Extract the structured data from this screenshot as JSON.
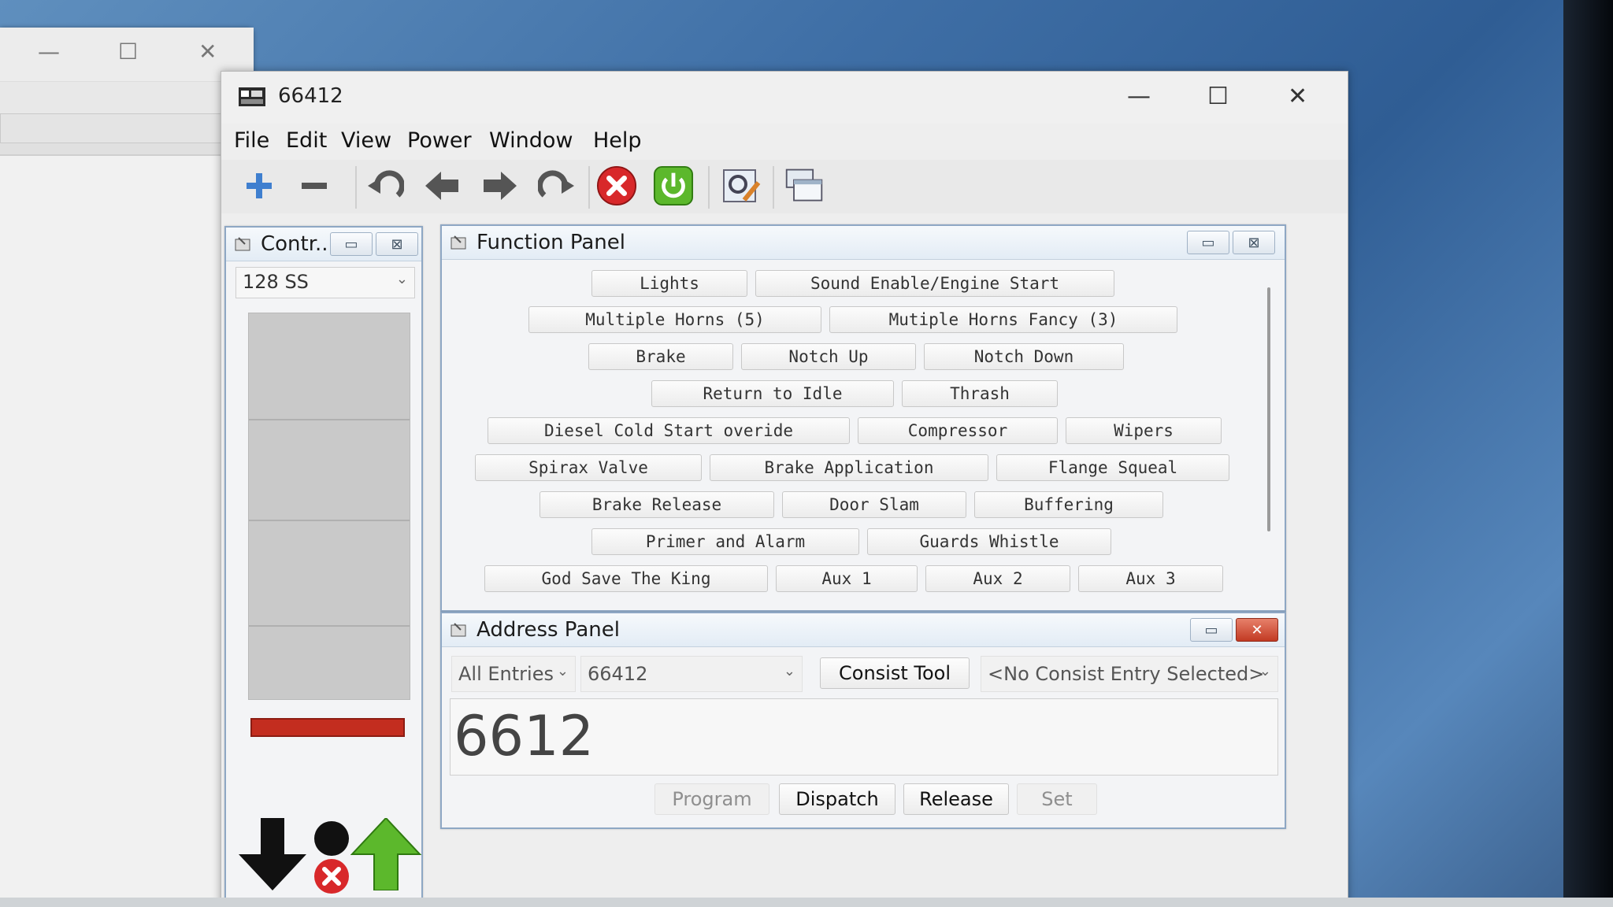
{
  "window": {
    "title": "66412",
    "menu": [
      "File",
      "Edit",
      "View",
      "Power",
      "Window",
      "Help"
    ]
  },
  "toolbar_icons": [
    "plus-icon",
    "minus-icon",
    "undo-icon",
    "back-arrow-icon",
    "forward-arrow-icon",
    "redo-icon",
    "stop-icon",
    "power-icon",
    "edit-roster-icon",
    "windows-icon"
  ],
  "control_panel": {
    "title": "Contr...",
    "speed_steps": "128 SS",
    "speed_level": 0
  },
  "function_panel": {
    "title": "Function Panel",
    "functions": [
      "Lights",
      "Sound Enable/Engine Start",
      "Multiple Horns (5)",
      "Mutiple Horns Fancy (3)",
      "Brake",
      "Notch Up",
      "Notch Down",
      "Return to Idle",
      "Thrash",
      "Diesel Cold Start overide",
      "Compressor",
      "Wipers",
      "Spirax Valve",
      "Brake Application",
      "Flange Squeal",
      "Brake Release",
      "Door Slam",
      "Buffering",
      "Primer and Alarm",
      "Guards Whistle",
      "God Save The King",
      "Aux 1",
      "Aux 2",
      "Aux 3"
    ]
  },
  "address_panel": {
    "title": "Address Panel",
    "filter": "All Entries",
    "roster_entry": "66412",
    "consist_tool": "Consist Tool",
    "consist_entry": "<No Consist Entry Selected>",
    "address": "6612",
    "buttons": {
      "program": "Program",
      "dispatch": "Dispatch",
      "release": "Release",
      "set": "Set"
    }
  },
  "colors": {
    "stop": "#d8282a",
    "power": "#5cb82c",
    "thumb": "#c32d1f",
    "frame_border": "#8ea7c4"
  }
}
